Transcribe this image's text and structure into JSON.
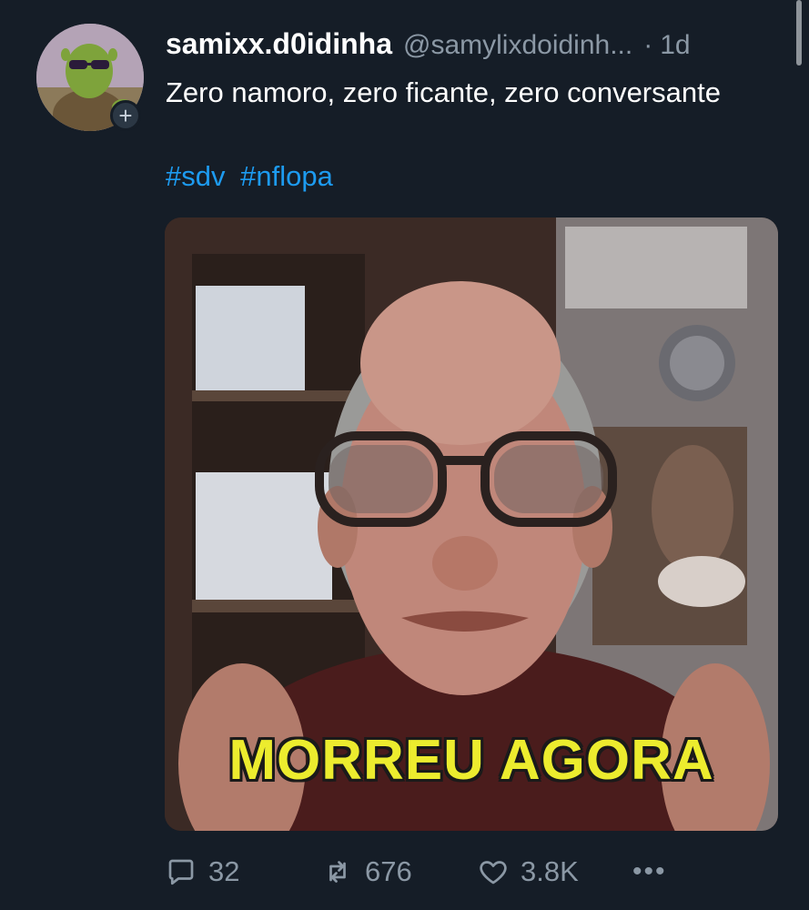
{
  "tweet": {
    "display_name": "samixx.d0idinha",
    "handle": "@samylixdoidinh...",
    "separator": "·",
    "time": "1d",
    "text": "Zero namoro, zero ficante, zero conversante",
    "hashtags": [
      "#sdv",
      "#nflopa"
    ]
  },
  "avatar": {
    "badge_icon": "plus-icon",
    "badge_glyph": "+"
  },
  "media": {
    "caption": "MORREU AGORA"
  },
  "actions": {
    "reply_count": "32",
    "retweet_count": "676",
    "like_count": "3.8K",
    "more_glyph": "•••"
  },
  "colors": {
    "background": "#151d27",
    "link": "#1d9bf0",
    "muted": "#8b98a5",
    "caption": "#ecec2e"
  }
}
